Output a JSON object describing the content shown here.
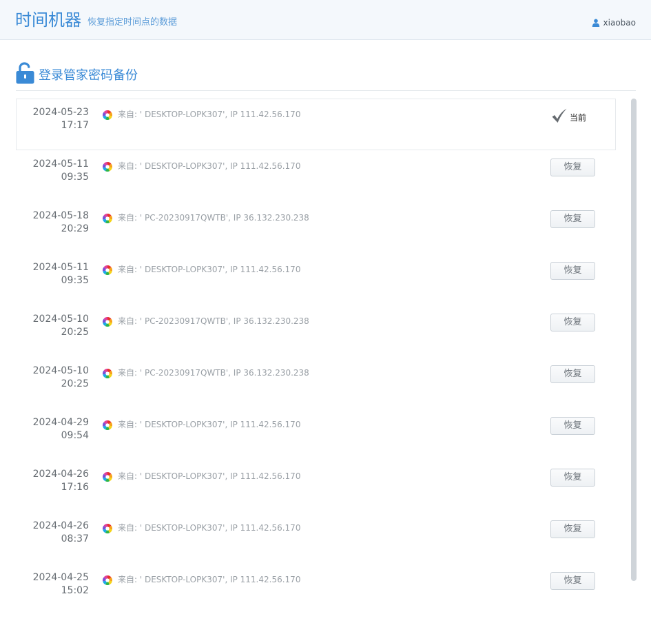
{
  "header": {
    "title": "时间机器",
    "subtitle": "恢复指定时间点的数据",
    "username": "xiaobao"
  },
  "section": {
    "title": "登录管家密码备份"
  },
  "current_label": "当前",
  "restore_label": "恢复",
  "rows": [
    {
      "date": "2024-05-23",
      "time": "17:17",
      "source": "来自: ' DESKTOP-LOPK307', IP 111.42.56.170",
      "current": true
    },
    {
      "date": "2024-05-11",
      "time": "09:35",
      "source": "来自: ' DESKTOP-LOPK307', IP 111.42.56.170",
      "current": false
    },
    {
      "date": "2024-05-18",
      "time": "20:29",
      "source": "来自: ' PC-20230917QWTB', IP 36.132.230.238",
      "current": false
    },
    {
      "date": "2024-05-11",
      "time": "09:35",
      "source": "来自: ' DESKTOP-LOPK307', IP 111.42.56.170",
      "current": false
    },
    {
      "date": "2024-05-10",
      "time": "20:25",
      "source": "来自: ' PC-20230917QWTB', IP 36.132.230.238",
      "current": false
    },
    {
      "date": "2024-05-10",
      "time": "20:25",
      "source": "来自: ' PC-20230917QWTB', IP 36.132.230.238",
      "current": false
    },
    {
      "date": "2024-04-29",
      "time": "09:54",
      "source": "来自: ' DESKTOP-LOPK307', IP 111.42.56.170",
      "current": false
    },
    {
      "date": "2024-04-26",
      "time": "17:16",
      "source": "来自: ' DESKTOP-LOPK307', IP 111.42.56.170",
      "current": false
    },
    {
      "date": "2024-04-26",
      "time": "08:37",
      "source": "来自: ' DESKTOP-LOPK307', IP 111.42.56.170",
      "current": false
    },
    {
      "date": "2024-04-25",
      "time": "15:02",
      "source": "来自: ' DESKTOP-LOPK307', IP 111.42.56.170",
      "current": false
    }
  ]
}
